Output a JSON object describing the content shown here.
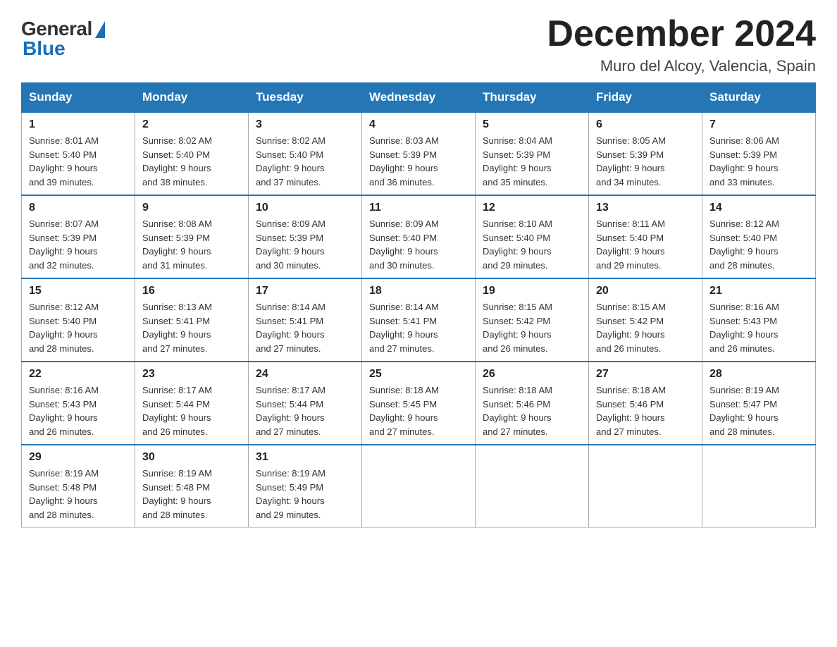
{
  "logo": {
    "general": "General",
    "blue": "Blue"
  },
  "title": "December 2024",
  "location": "Muro del Alcoy, Valencia, Spain",
  "days_of_week": [
    "Sunday",
    "Monday",
    "Tuesday",
    "Wednesday",
    "Thursday",
    "Friday",
    "Saturday"
  ],
  "weeks": [
    [
      {
        "day": "1",
        "sunrise": "8:01 AM",
        "sunset": "5:40 PM",
        "daylight": "9 hours and 39 minutes."
      },
      {
        "day": "2",
        "sunrise": "8:02 AM",
        "sunset": "5:40 PM",
        "daylight": "9 hours and 38 minutes."
      },
      {
        "day": "3",
        "sunrise": "8:02 AM",
        "sunset": "5:40 PM",
        "daylight": "9 hours and 37 minutes."
      },
      {
        "day": "4",
        "sunrise": "8:03 AM",
        "sunset": "5:39 PM",
        "daylight": "9 hours and 36 minutes."
      },
      {
        "day": "5",
        "sunrise": "8:04 AM",
        "sunset": "5:39 PM",
        "daylight": "9 hours and 35 minutes."
      },
      {
        "day": "6",
        "sunrise": "8:05 AM",
        "sunset": "5:39 PM",
        "daylight": "9 hours and 34 minutes."
      },
      {
        "day": "7",
        "sunrise": "8:06 AM",
        "sunset": "5:39 PM",
        "daylight": "9 hours and 33 minutes."
      }
    ],
    [
      {
        "day": "8",
        "sunrise": "8:07 AM",
        "sunset": "5:39 PM",
        "daylight": "9 hours and 32 minutes."
      },
      {
        "day": "9",
        "sunrise": "8:08 AM",
        "sunset": "5:39 PM",
        "daylight": "9 hours and 31 minutes."
      },
      {
        "day": "10",
        "sunrise": "8:09 AM",
        "sunset": "5:39 PM",
        "daylight": "9 hours and 30 minutes."
      },
      {
        "day": "11",
        "sunrise": "8:09 AM",
        "sunset": "5:40 PM",
        "daylight": "9 hours and 30 minutes."
      },
      {
        "day": "12",
        "sunrise": "8:10 AM",
        "sunset": "5:40 PM",
        "daylight": "9 hours and 29 minutes."
      },
      {
        "day": "13",
        "sunrise": "8:11 AM",
        "sunset": "5:40 PM",
        "daylight": "9 hours and 29 minutes."
      },
      {
        "day": "14",
        "sunrise": "8:12 AM",
        "sunset": "5:40 PM",
        "daylight": "9 hours and 28 minutes."
      }
    ],
    [
      {
        "day": "15",
        "sunrise": "8:12 AM",
        "sunset": "5:40 PM",
        "daylight": "9 hours and 28 minutes."
      },
      {
        "day": "16",
        "sunrise": "8:13 AM",
        "sunset": "5:41 PM",
        "daylight": "9 hours and 27 minutes."
      },
      {
        "day": "17",
        "sunrise": "8:14 AM",
        "sunset": "5:41 PM",
        "daylight": "9 hours and 27 minutes."
      },
      {
        "day": "18",
        "sunrise": "8:14 AM",
        "sunset": "5:41 PM",
        "daylight": "9 hours and 27 minutes."
      },
      {
        "day": "19",
        "sunrise": "8:15 AM",
        "sunset": "5:42 PM",
        "daylight": "9 hours and 26 minutes."
      },
      {
        "day": "20",
        "sunrise": "8:15 AM",
        "sunset": "5:42 PM",
        "daylight": "9 hours and 26 minutes."
      },
      {
        "day": "21",
        "sunrise": "8:16 AM",
        "sunset": "5:43 PM",
        "daylight": "9 hours and 26 minutes."
      }
    ],
    [
      {
        "day": "22",
        "sunrise": "8:16 AM",
        "sunset": "5:43 PM",
        "daylight": "9 hours and 26 minutes."
      },
      {
        "day": "23",
        "sunrise": "8:17 AM",
        "sunset": "5:44 PM",
        "daylight": "9 hours and 26 minutes."
      },
      {
        "day": "24",
        "sunrise": "8:17 AM",
        "sunset": "5:44 PM",
        "daylight": "9 hours and 27 minutes."
      },
      {
        "day": "25",
        "sunrise": "8:18 AM",
        "sunset": "5:45 PM",
        "daylight": "9 hours and 27 minutes."
      },
      {
        "day": "26",
        "sunrise": "8:18 AM",
        "sunset": "5:46 PM",
        "daylight": "9 hours and 27 minutes."
      },
      {
        "day": "27",
        "sunrise": "8:18 AM",
        "sunset": "5:46 PM",
        "daylight": "9 hours and 27 minutes."
      },
      {
        "day": "28",
        "sunrise": "8:19 AM",
        "sunset": "5:47 PM",
        "daylight": "9 hours and 28 minutes."
      }
    ],
    [
      {
        "day": "29",
        "sunrise": "8:19 AM",
        "sunset": "5:48 PM",
        "daylight": "9 hours and 28 minutes."
      },
      {
        "day": "30",
        "sunrise": "8:19 AM",
        "sunset": "5:48 PM",
        "daylight": "9 hours and 28 minutes."
      },
      {
        "day": "31",
        "sunrise": "8:19 AM",
        "sunset": "5:49 PM",
        "daylight": "9 hours and 29 minutes."
      },
      null,
      null,
      null,
      null
    ]
  ],
  "labels": {
    "sunrise": "Sunrise:",
    "sunset": "Sunset:",
    "daylight": "Daylight:"
  }
}
